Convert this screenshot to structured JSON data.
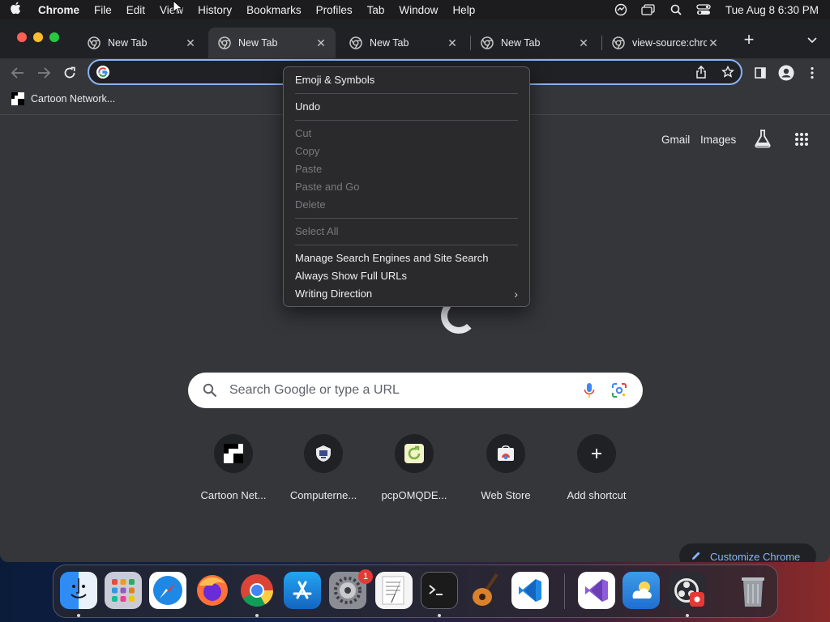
{
  "menubar": {
    "app_name": "Chrome",
    "items": [
      "File",
      "Edit",
      "View",
      "History",
      "Bookmarks",
      "Profiles",
      "Tab",
      "Window",
      "Help"
    ],
    "clock": "Tue Aug 8  6:30 PM"
  },
  "tabs": [
    {
      "title": "New Tab",
      "active": false
    },
    {
      "title": "New Tab",
      "active": true
    },
    {
      "title": "New Tab",
      "active": false
    },
    {
      "title": "New Tab",
      "active": false
    },
    {
      "title": "view-source:chro",
      "active": false
    }
  ],
  "omnibox": {
    "value": "",
    "placeholder": ""
  },
  "bookmarks": [
    {
      "label": "Cartoon Network..."
    }
  ],
  "ntp": {
    "links": {
      "gmail": "Gmail",
      "images": "Images"
    },
    "search_placeholder": "Search Google or type a URL",
    "shortcuts": [
      {
        "label": "Cartoon Net...",
        "icon": "cartoon-network-icon"
      },
      {
        "label": "Computerne...",
        "icon": "computer-network-icon"
      },
      {
        "label": "pcpOMQDE...",
        "icon": "refresh-green-icon"
      },
      {
        "label": "Web Store",
        "icon": "web-store-icon"
      },
      {
        "label": "Add shortcut",
        "icon": "plus-icon"
      }
    ],
    "customize_label": "Customize Chrome"
  },
  "context_menu": {
    "groups": [
      [
        {
          "label": "Emoji & Symbols",
          "enabled": true
        }
      ],
      [
        {
          "label": "Undo",
          "enabled": true
        }
      ],
      [
        {
          "label": "Cut",
          "enabled": false
        },
        {
          "label": "Copy",
          "enabled": false
        },
        {
          "label": "Paste",
          "enabled": false
        },
        {
          "label": "Paste and Go",
          "enabled": false
        },
        {
          "label": "Delete",
          "enabled": false
        }
      ],
      [
        {
          "label": "Select All",
          "enabled": false
        }
      ],
      [
        {
          "label": "Manage Search Engines and Site Search",
          "enabled": true
        },
        {
          "label": "Always Show Full URLs",
          "enabled": true
        },
        {
          "label": "Writing Direction",
          "enabled": true,
          "submenu": true
        }
      ]
    ]
  },
  "dock": {
    "apps": [
      "Finder",
      "Launchpad",
      "Safari",
      "Firefox",
      "Chrome",
      "App Store",
      "System Settings",
      "TextEdit",
      "Terminal",
      "GarageBand",
      "Visual Studio Code",
      "Visual Studio",
      "Weather",
      "OBS",
      "Trash"
    ],
    "settings_badge": "1"
  },
  "colors": {
    "accent": "#8ab4f8",
    "toolbar": "#35363a",
    "tabstrip": "#202124"
  }
}
